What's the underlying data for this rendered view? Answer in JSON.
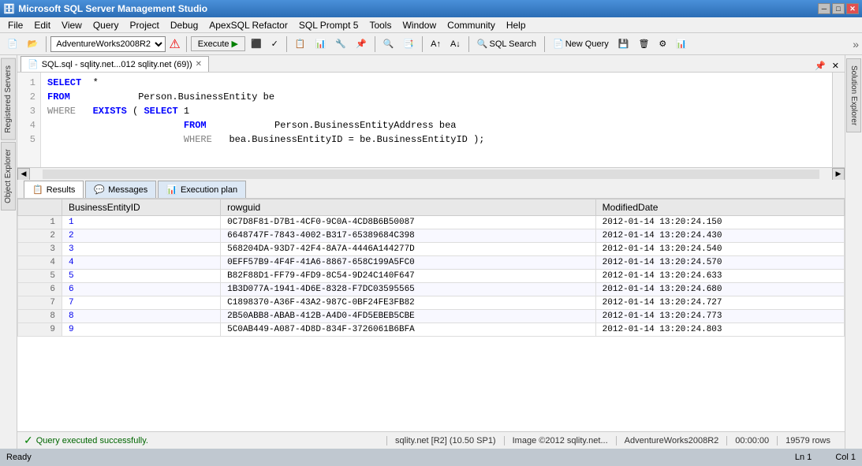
{
  "titleBar": {
    "icon": "🗄",
    "title": "Microsoft SQL Server Management Studio",
    "minimizeLabel": "─",
    "maximizeLabel": "□",
    "closeLabel": "✕"
  },
  "menuBar": {
    "items": [
      "File",
      "Edit",
      "View",
      "Query",
      "Project",
      "Debug",
      "ApexSQL Refactor",
      "SQL Prompt 5",
      "Tools",
      "Window",
      "Community",
      "Help"
    ]
  },
  "toolbar": {
    "dbSelector": "AdventureWorks2008R2",
    "executeLabel": "Execute",
    "sqlSearchLabel": "SQL Search",
    "newQueryLabel": "New Query"
  },
  "queryTab": {
    "label": "SQL.sql - sqlity.net...012 sqlity.net (69))"
  },
  "sqlEditor": {
    "lines": [
      "1",
      "2",
      "3",
      "4",
      "5"
    ],
    "content": [
      {
        "line": 1,
        "text": "SELECT\t*"
      },
      {
        "line": 2,
        "text": "FROM\t\tPerson.BusinessEntity be"
      },
      {
        "line": 3,
        "text": "WHERE\tEXISTS ( SELECT 1"
      },
      {
        "line": 4,
        "text": "\t\t\t\tFROM\t\tPerson.BusinessEntityAddress bea"
      },
      {
        "line": 5,
        "text": "\t\t\t\tWHERE\tbea.BusinessEntityID = be.BusinessEntityID );"
      }
    ]
  },
  "resultsTabs": [
    {
      "label": "Results",
      "icon": "📋",
      "active": true
    },
    {
      "label": "Messages",
      "icon": "💬",
      "active": false
    },
    {
      "label": "Execution plan",
      "icon": "📊",
      "active": false
    }
  ],
  "resultsTable": {
    "columns": [
      "BusinessEntityID",
      "rowguid",
      "ModifiedDate"
    ],
    "rows": [
      {
        "num": 1,
        "id": "1",
        "rowguid": "0C7D8F81-D7B1-4CF0-9C0A-4CD8B6B50087",
        "date": "2012-01-14 13:20:24.150"
      },
      {
        "num": 2,
        "id": "2",
        "rowguid": "6648747F-7843-4002-B317-65389684C398",
        "date": "2012-01-14 13:20:24.430"
      },
      {
        "num": 3,
        "id": "3",
        "rowguid": "568204DA-93D7-42F4-8A7A-4446A144277D",
        "date": "2012-01-14 13:20:24.540"
      },
      {
        "num": 4,
        "id": "4",
        "rowguid": "0EFF57B9-4F4F-41A6-8867-658C199A5FC0",
        "date": "2012-01-14 13:20:24.570"
      },
      {
        "num": 5,
        "id": "5",
        "rowguid": "B82F88D1-FF79-4FD9-8C54-9D24C140F647",
        "date": "2012-01-14 13:20:24.633"
      },
      {
        "num": 6,
        "id": "6",
        "rowguid": "1B3D077A-1941-4D6E-8328-F7DC03595565",
        "date": "2012-01-14 13:20:24.680"
      },
      {
        "num": 7,
        "id": "7",
        "rowguid": "C1898370-A36F-43A2-987C-0BF24FE3FB82",
        "date": "2012-01-14 13:20:24.727"
      },
      {
        "num": 8,
        "id": "8",
        "rowguid": "2B50ABB8-ABAB-412B-A4D0-4FD5EBEB5CBE",
        "date": "2012-01-14 13:20:24.773"
      },
      {
        "num": 9,
        "id": "9",
        "rowguid": "5C0AB449-A087-4D8D-834F-3726061B6BFA",
        "date": "2012-01-14 13:20:24.803"
      }
    ]
  },
  "statusBar": {
    "successMsg": "Query executed successfully.",
    "connection": "sqlity.net [R2] (10.50 SP1)",
    "image": "Image ©2012 sqlity.net...",
    "db": "AdventureWorks2008R2",
    "time": "00:00:00",
    "rows": "19579 rows"
  },
  "bottomBar": {
    "readyLabel": "Ready",
    "lineLabel": "Ln 1",
    "colLabel": "Col 1"
  },
  "leftSidebar": {
    "tabs": [
      "Registered Servers",
      "Object Explorer"
    ]
  },
  "rightSidebar": {
    "tabs": [
      "Solution Explorer"
    ]
  }
}
